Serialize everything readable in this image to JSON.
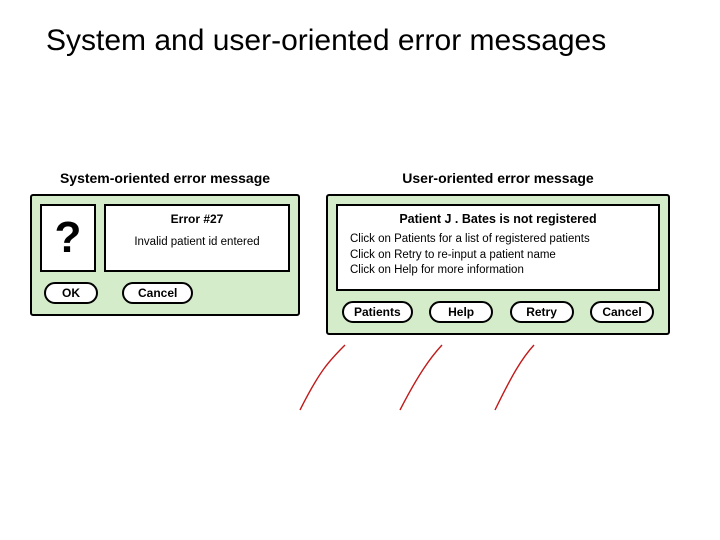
{
  "title": "System and user-oriented error messages",
  "system_panel": {
    "label": "System-oriented error message",
    "question_mark": "?",
    "error_title": "Error #27",
    "error_body": "Invalid patient id entered",
    "buttons": {
      "ok": "OK",
      "cancel": "Cancel"
    }
  },
  "user_panel": {
    "label": "User-oriented error message",
    "title": "Patient J . Bates is not registered",
    "lines": [
      "Click on Patients for a list of registered patients",
      "Click on Retry to re-input a patient name",
      "Click on Help for more information"
    ],
    "buttons": {
      "patients": "Patients",
      "help": "Help",
      "retry": "Retry",
      "cancel": "Cancel"
    }
  }
}
